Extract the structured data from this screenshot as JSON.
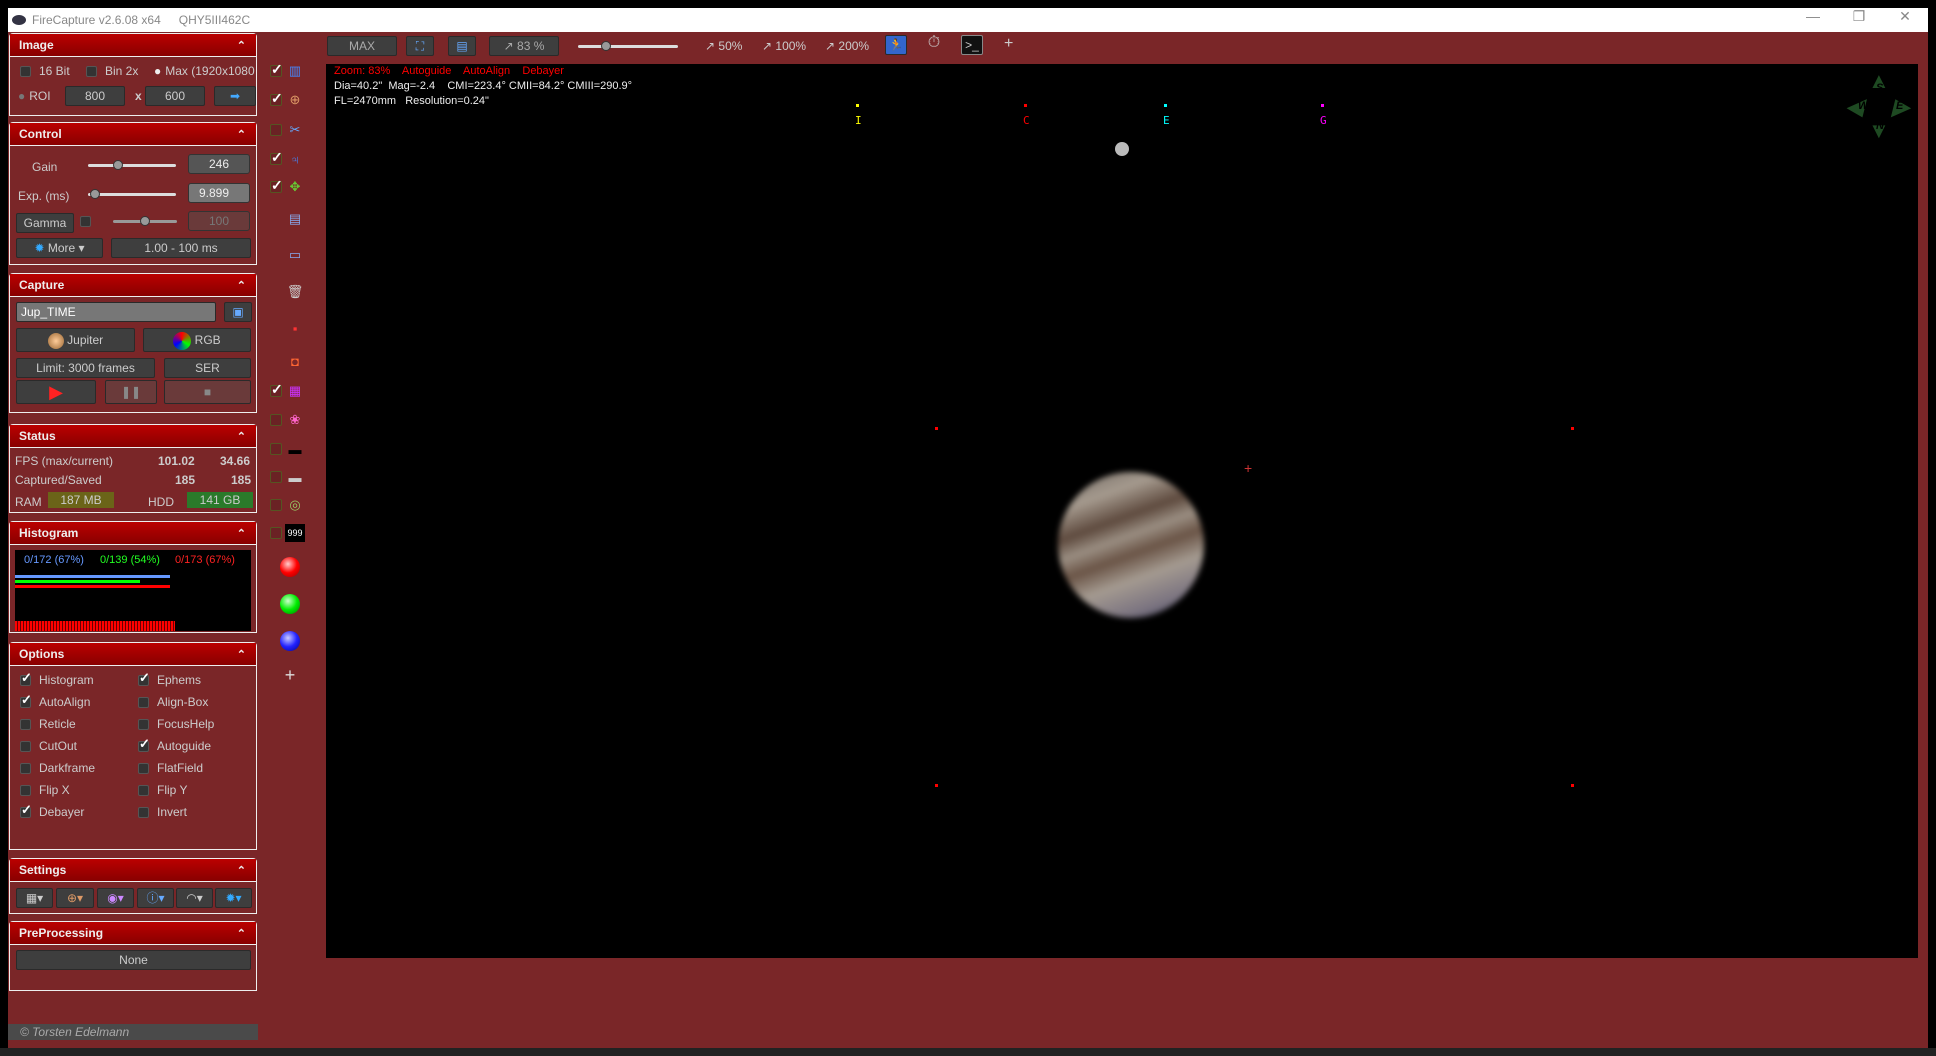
{
  "window": {
    "app_title": "FireCapture v2.6.08  x64",
    "camera": "QHY5III462C",
    "minimize": "—",
    "maximize": "❐",
    "close": "✕"
  },
  "image_panel": {
    "title": "Image",
    "bit16": "16 Bit",
    "bin2x": "Bin 2x",
    "max": "Max (1920x1080",
    "roi": "ROI",
    "roi_w": "800",
    "x": "x",
    "roi_h": "600"
  },
  "control_panel": {
    "title": "Control",
    "gain_label": "Gain",
    "gain_value": "246",
    "gain_fraction": 0.32,
    "exp_label": "Exp. (ms)",
    "exp_value": "9.899",
    "exp_fraction": 0.03,
    "gamma_label": "Gamma",
    "gamma_value": "100",
    "gamma_fraction": 0.5,
    "more": "More",
    "range": "1.00 - 100 ms"
  },
  "capture_panel": {
    "title": "Capture",
    "filename": "Jup_TIME",
    "object": "Jupiter",
    "filter": "RGB",
    "limit": "Limit: 3000 frames",
    "format": "SER"
  },
  "status_panel": {
    "title": "Status",
    "fps_label": "FPS (max/current)",
    "fps_max": "101.02",
    "fps_current": "34.66",
    "captured_label": "Captured/Saved",
    "captured": "185",
    "saved": "185",
    "ram_label": "RAM",
    "ram": "187 MB",
    "hdd_label": "HDD",
    "hdd": "141 GB"
  },
  "histogram_panel": {
    "title": "Histogram",
    "blue": "0/172 (67%)",
    "green": "0/139 (54%)",
    "red": "0/173 (67%)",
    "blue_pct": 67,
    "green_pct": 54,
    "red_pct": 67
  },
  "options_panel": {
    "title": "Options",
    "items": [
      {
        "label": "Histogram",
        "checked": true
      },
      {
        "label": "Ephems",
        "checked": true
      },
      {
        "label": "AutoAlign",
        "checked": true
      },
      {
        "label": "Align-Box",
        "checked": false
      },
      {
        "label": "Reticle",
        "checked": false
      },
      {
        "label": "FocusHelp",
        "checked": false
      },
      {
        "label": "CutOut",
        "checked": false
      },
      {
        "label": "Autoguide",
        "checked": true
      },
      {
        "label": "Darkframe",
        "checked": false
      },
      {
        "label": "FlatField",
        "checked": false
      },
      {
        "label": "Flip X",
        "checked": false
      },
      {
        "label": "Flip Y",
        "checked": false
      },
      {
        "label": "Debayer",
        "checked": true
      },
      {
        "label": "Invert",
        "checked": false
      }
    ]
  },
  "settings_panel": {
    "title": "Settings"
  },
  "preprocessing_panel": {
    "title": "PreProcessing",
    "value": "None"
  },
  "footer": "© Torsten Edelmann",
  "toolbar": {
    "max": "MAX",
    "zoom": "83 %",
    "zoom_fraction": 0.25,
    "z50": "50%",
    "z100": "100%",
    "z200": "200%",
    "plus": "+"
  },
  "overlay": {
    "line1": [
      "Zoom: 83%",
      "Autoguide",
      "AutoAlign",
      "Debayer"
    ],
    "line2": "Dia=40.2\"  Mag=-2.4    CMI=223.4° CMII=84.2° CMIII=290.9°",
    "line3": "FL=2470mm   Resolution=0.24\""
  },
  "moons": [
    {
      "label": "I",
      "color": "#ffff00"
    },
    {
      "label": "C",
      "color": "#ff0000"
    },
    {
      "label": "E",
      "color": "#00ffff"
    },
    {
      "label": "G",
      "color": "#ff00ff"
    }
  ],
  "compass": {
    "n": "N",
    "s": "S",
    "e": "E",
    "w": "W"
  },
  "icon_add": "+"
}
